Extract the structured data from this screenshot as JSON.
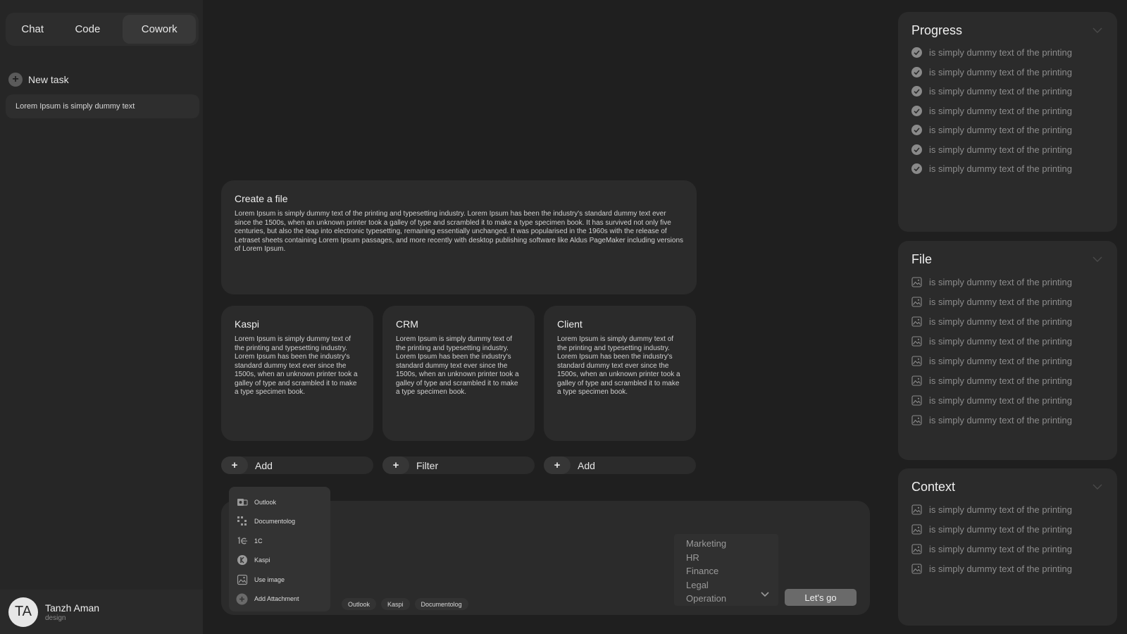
{
  "sidebar": {
    "tabs": [
      "Chat",
      "Code",
      "Cowork"
    ],
    "new_task_label": "New task",
    "tasks": [
      "Lorem Ipsum is simply dummy text"
    ],
    "user": {
      "initials": "TA",
      "name": "Tanzh Aman",
      "role": "design"
    }
  },
  "main": {
    "create_card": {
      "title": "Create a file",
      "body": "Lorem Ipsum is simply dummy text of the printing and typesetting industry. Lorem Ipsum has been the industry's standard dummy text ever since the 1500s, when an unknown printer took a galley of type and scrambled it to make a type specimen book. It has survived not only five centuries, but also the leap into electronic typesetting, remaining essentially unchanged. It was popularised in the 1960s with the release of Letraset sheets containing Lorem Ipsum passages, and more recently with desktop publishing software like Aldus PageMaker including versions of Lorem Ipsum."
    },
    "cards": [
      {
        "title": "Kaspi",
        "body": "Lorem Ipsum is simply dummy text of the printing and typesetting industry. Lorem Ipsum has been the industry's standard dummy text ever since the 1500s, when an unknown printer took a galley of type and scrambled it to make a type specimen book."
      },
      {
        "title": "CRM",
        "body": "Lorem Ipsum is simply dummy text of the printing and typesetting industry. Lorem Ipsum has been the industry's standard dummy text ever since the 1500s, when an unknown printer took a galley of type and scrambled it to make a type specimen book."
      },
      {
        "title": "Client",
        "body": "Lorem Ipsum is simply dummy text of the printing and typesetting industry. Lorem Ipsum has been the industry's standard dummy text ever since the 1500s, when an unknown printer took a galley of type and scrambled it to make a type specimen book."
      }
    ],
    "actions": [
      {
        "icon": "+",
        "label": "Add"
      },
      {
        "icon": "+",
        "label": "Filter"
      },
      {
        "icon": "+",
        "label": "Add"
      }
    ]
  },
  "composer": {
    "attach_menu": [
      {
        "icon": "outlook-icon",
        "label": "Outlook"
      },
      {
        "icon": "documentolog-icon",
        "label": "Documentolog"
      },
      {
        "icon": "1c-icon",
        "label": "1C"
      },
      {
        "icon": "kaspi-icon",
        "label": "Kaspi"
      },
      {
        "icon": "image-icon",
        "label": "Use image"
      },
      {
        "icon": "plus-icon",
        "label": "Add Attachment"
      }
    ],
    "chips": [
      "Outlook",
      "Kaspi",
      "Documentolog"
    ],
    "departments": [
      "Marketing",
      "HR",
      "Finance",
      "Legal",
      "Operation"
    ],
    "submit_label": "Let's go"
  },
  "panels": {
    "progress": {
      "title": "Progress",
      "items": [
        "is simply dummy text of the printing",
        "is simply dummy text of the printing",
        "is simply dummy text of the printing",
        "is simply dummy text of the printing",
        "is simply dummy text of the printing",
        "is simply dummy text of the printing",
        "is simply dummy text of the printing"
      ]
    },
    "file": {
      "title": "File",
      "items": [
        "is simply dummy text of the printing",
        "is simply dummy text of the printing",
        "is simply dummy text of the printing",
        "is simply dummy text of the printing",
        "is simply dummy text of the printing",
        "is simply dummy text of the printing",
        "is simply dummy text of the printing",
        "is simply dummy text of the printing"
      ]
    },
    "context": {
      "title": "Context",
      "items": [
        "is simply dummy text of the printing",
        "is simply dummy text of the printing",
        "is simply dummy text of the printing",
        "is simply dummy text of the printing"
      ]
    }
  }
}
